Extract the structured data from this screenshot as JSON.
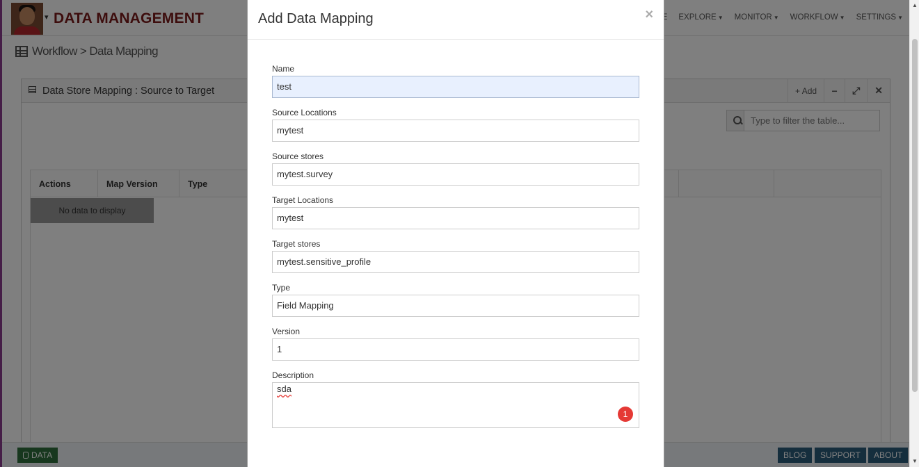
{
  "header": {
    "brand": "DATA MANAGEMENT",
    "nav": [
      {
        "label": "ORE"
      },
      {
        "label": "EXPLORE"
      },
      {
        "label": "MONITOR"
      },
      {
        "label": "WORKFLOW"
      },
      {
        "label": "SETTINGS"
      }
    ]
  },
  "breadcrumb": "Workflow > Data Mapping",
  "panel": {
    "title": "Data Store Mapping : Source to Target",
    "add_label": "+ Add",
    "filter_placeholder": "Type to filter the table...",
    "columns": [
      "Actions",
      "Map Version",
      "Type"
    ],
    "empty_text": "No data to display"
  },
  "footer": {
    "data_label": "DATA",
    "blog_label": "BLOG",
    "support_label": "SUPPORT",
    "about_label": "ABOUT"
  },
  "modal": {
    "title": "Add Data Mapping",
    "close": "×",
    "fields": {
      "name": {
        "label": "Name",
        "value": "test"
      },
      "source_locations": {
        "label": "Source Locations",
        "value": "mytest"
      },
      "source_stores": {
        "label": "Source stores",
        "value": "mytest.survey"
      },
      "target_locations": {
        "label": "Target Locations",
        "value": "mytest"
      },
      "target_stores": {
        "label": "Target stores",
        "value": "mytest.sensitive_profile"
      },
      "type": {
        "label": "Type",
        "value": "Field Mapping"
      },
      "version": {
        "label": "Version",
        "value": "1"
      },
      "description": {
        "label": "Description",
        "value": "sda"
      }
    },
    "error_count": "1"
  }
}
